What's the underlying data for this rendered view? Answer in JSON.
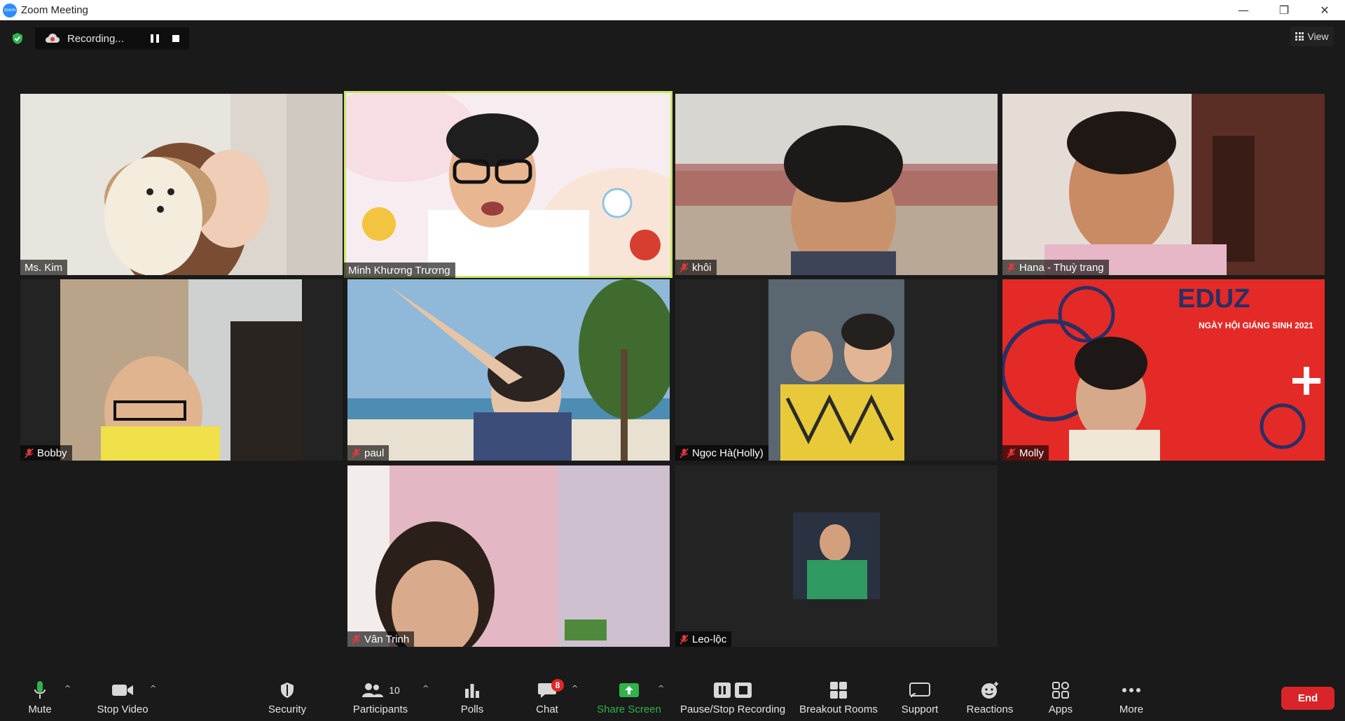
{
  "window": {
    "title": "Zoom Meeting",
    "logo_text": "zoom",
    "minimize": "—",
    "restore": "❐",
    "close": "✕"
  },
  "recording": {
    "label": "Recording..."
  },
  "view": {
    "label": "View"
  },
  "participants_tiles": [
    {
      "name": "Ms. Kim",
      "muted": false
    },
    {
      "name": "Minh Khương Trương",
      "muted": false,
      "active_speaker": true
    },
    {
      "name": "khôi",
      "muted": true
    },
    {
      "name": "Hana - Thuỳ trang",
      "muted": true
    },
    {
      "name": "Bobby",
      "muted": true
    },
    {
      "name": "paul",
      "muted": true
    },
    {
      "name": "Ngọc Hà(Holly)",
      "muted": true
    },
    {
      "name": "Molly",
      "muted": true
    },
    {
      "name": "Vân Trinh",
      "muted": true
    },
    {
      "name": "Leo-lộc",
      "muted": true
    }
  ],
  "toolbar": {
    "mute": "Mute",
    "stop_video": "Stop Video",
    "security": "Security",
    "participants": "Participants",
    "participants_count": "10",
    "polls": "Polls",
    "chat": "Chat",
    "chat_badge": "8",
    "share_screen": "Share Screen",
    "pause_stop_recording": "Pause/Stop Recording",
    "breakout_rooms": "Breakout Rooms",
    "support": "Support",
    "reactions": "Reactions",
    "apps": "Apps",
    "more": "More",
    "end": "End"
  },
  "colors": {
    "accent_green": "#2fb34a",
    "end_red": "#d9252a",
    "speaker_highlight": "#cbe66b",
    "muted_red": "#e0383e"
  }
}
